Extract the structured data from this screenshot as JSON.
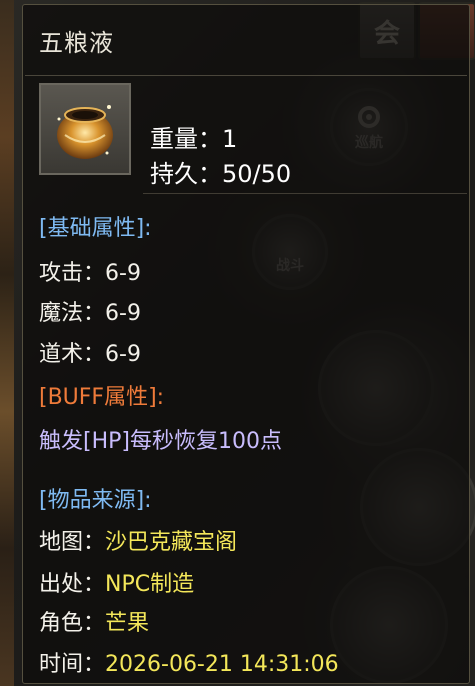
{
  "item": {
    "name": "五粮液",
    "icon": "golden-pot-icon",
    "weight_label": "重量：",
    "weight_value": "1",
    "durability_label": "持久：",
    "durability_value": "50/50"
  },
  "base_attrs": {
    "heading": "[基础属性]:",
    "rows": [
      {
        "label": "攻击：",
        "value": "6-9"
      },
      {
        "label": "魔法：",
        "value": "6-9"
      },
      {
        "label": "道术：",
        "value": "6-9"
      }
    ]
  },
  "buff_attrs": {
    "heading": "[BUFF属性]:",
    "effect": "触发[HP]每秒恢复100点"
  },
  "source": {
    "heading": "[物品来源]:",
    "rows": [
      {
        "label": "地图：",
        "value": "沙巴克藏宝阁"
      },
      {
        "label": "出处：",
        "value": "NPC制造"
      },
      {
        "label": "角色：",
        "value": "芒果"
      },
      {
        "label": "时间：",
        "value": "2026-06-21 14:31:06"
      }
    ]
  },
  "background": {
    "top_button_label": "会",
    "patrol_label": "巡航",
    "battle_label": "战斗"
  },
  "colors": {
    "title": "#e8e4d8",
    "section_blue": "#7fbaf2",
    "section_orange": "#ef7b3a",
    "effect_lavender": "#c9bdfd",
    "value_yellow": "#f4e75a",
    "label_white": "#f3f1ea"
  }
}
